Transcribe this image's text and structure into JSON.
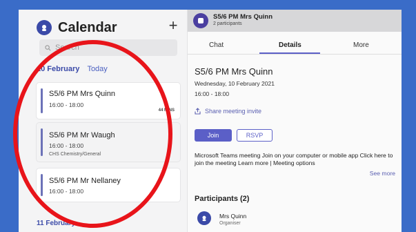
{
  "calendar": {
    "title": "Calendar",
    "add_label": "+",
    "search_placeholder": "Search",
    "date_header": "10 February",
    "today_label": "Today",
    "events": [
      {
        "title": "S5/6 PM Mrs Quinn",
        "time": "16:00 - 18:00",
        "badge": "44 MINS",
        "sub": ""
      },
      {
        "title": "S5/6 PM  Mr Waugh",
        "time": "16:00 - 18:00",
        "badge": "",
        "sub": "CHS Chemistry/General"
      },
      {
        "title": "S5/6 PM  Mr Nellaney",
        "time": "16:00 - 18:00",
        "badge": "",
        "sub": ""
      }
    ],
    "next_date": "11 February"
  },
  "meeting": {
    "header_title": "S5/6 PM Mrs Quinn",
    "header_sub": "2 participants",
    "tabs": [
      "Chat",
      "Details",
      "More"
    ],
    "active_tab": "Details",
    "title": "S5/6 PM Mrs Quinn",
    "date": "Wednesday, 10 February 2021",
    "time": "16:00 - 18:00",
    "share_label": "Share meeting invite",
    "join_label": "Join",
    "rsvp_label": "RSVP",
    "description": "Microsoft Teams meeting Join on your computer or mobile app Click here to join the meeting Learn more | Meeting options",
    "see_more": "See more",
    "participants_header": "Participants (2)",
    "participant": {
      "name": "Mrs Quinn",
      "role": "Organiser"
    }
  },
  "colors": {
    "accent": "#5b5fc7",
    "frame": "#3a6cc8",
    "highlight": "#e8141a"
  }
}
